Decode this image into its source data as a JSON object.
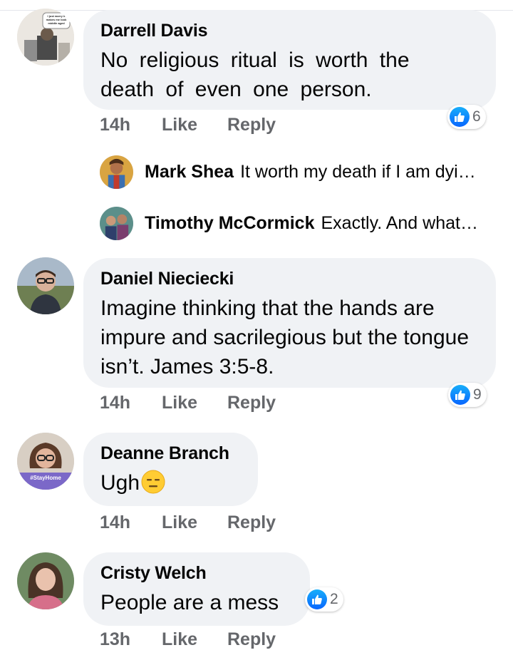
{
  "comments": [
    {
      "author": "Darrell Davis",
      "text": "No religious ritual is worth the death of even one person.",
      "time": "14h",
      "like": "Like",
      "reply": "Reply",
      "reactions": "6",
      "avatar_caption": "I just worry it makes me look middle aged",
      "replies": [
        {
          "author": "Mark Shea",
          "text": "It worth my death if I am dyi…"
        },
        {
          "author": "Timothy McCormick",
          "text": "Exactly. And what…"
        }
      ]
    },
    {
      "author": "Daniel Nieciecki",
      "text": "Imagine thinking that the hands are impure and sacrilegious but the tongue isn’t. James 3:5-8.",
      "time": "14h",
      "like": "Like",
      "reply": "Reply",
      "reactions": "9"
    },
    {
      "author": "Deanne Branch",
      "text": "Ugh",
      "emoji": "expressionless-face-icon",
      "time": "14h",
      "like": "Like",
      "reply": "Reply",
      "avatar_badge": "#StayHome"
    },
    {
      "author": "Cristy Welch",
      "text": "People are a mess",
      "time": "13h",
      "like": "Like",
      "reply": "Reply",
      "reactions": "2"
    }
  ],
  "colors": {
    "bubble": "#f0f2f5",
    "meta_text": "#65676b",
    "like_blue": "#0866ff",
    "badge_purple": "#7b68c8"
  }
}
